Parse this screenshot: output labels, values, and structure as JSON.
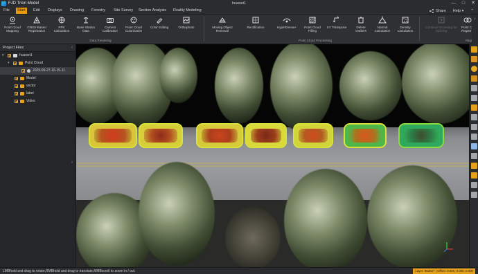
{
  "app": {
    "title": "FJD Trion Model",
    "window_title": "huawei1"
  },
  "window_controls": {
    "minimize": "—",
    "maximize": "□",
    "close": "✕"
  },
  "menu": {
    "items": [
      "File",
      "Start",
      "Edit",
      "Displays",
      "Drawing",
      "Forestry",
      "Site Survey",
      "Section Analysis",
      "Reality Modeling"
    ],
    "active": "Start",
    "share_label": "Share",
    "help_label": "Help"
  },
  "ribbon": {
    "buttons": [
      {
        "label": "Point Cloud\nMapping",
        "icon": "mapping-icon"
      },
      {
        "label": "GNSS-Based\nRegistration",
        "icon": "gnss-icon"
      },
      {
        "label": "PPK\nCalculation",
        "icon": "ppk-icon"
      },
      {
        "label": "Base Station\nData",
        "icon": "base-station-icon"
      },
      {
        "label": "Camera\nCalibration",
        "icon": "camera-icon"
      },
      {
        "label": "Point Cloud\nColorization",
        "icon": "colorize-icon"
      },
      {
        "label": "Color Editing",
        "icon": "color-edit-icon"
      },
      {
        "label": "Orthophoto",
        "icon": "orthophoto-icon"
      },
      {
        "label": "Moving Object\nRemoval",
        "icon": "moving-object-icon"
      },
      {
        "label": "Rectification",
        "icon": "rectification-icon"
      },
      {
        "label": "HyperDense+",
        "icon": "hyperdense-icon"
      },
      {
        "label": "Point Cloud\nFilling",
        "icon": "filling-icon"
      },
      {
        "label": "XY Transpose",
        "icon": "transpose-icon"
      },
      {
        "label": "Delete\nOutliers",
        "icon": "delete-outliers-icon"
      },
      {
        "label": "Normal\nCalculation",
        "icon": "normal-icon"
      },
      {
        "label": "Density\nCalculation",
        "icon": "density-icon"
      },
      {
        "label": "Continue Scanning for\nSplicing",
        "icon": "continue-scan-icon"
      },
      {
        "label": "Point C\nRegistr",
        "icon": "registration-icon"
      }
    ],
    "groups": {
      "data_resolving": "Data Resolving",
      "point_cloud_processing": "Point Cloud Processing",
      "registration_short": "Regis"
    }
  },
  "project_panel": {
    "title": "Project Files",
    "tree": [
      {
        "label": "huawei1",
        "level": 0,
        "type": "project"
      },
      {
        "label": "Point Cloud",
        "level": 1,
        "type": "folder"
      },
      {
        "label": "2025-05-27-15-15-11",
        "level": 2,
        "type": "item",
        "selected": true
      },
      {
        "label": "Model",
        "level": 1,
        "type": "folder"
      },
      {
        "label": "vector",
        "level": 1,
        "type": "folder"
      },
      {
        "label": "label",
        "level": 1,
        "type": "folder"
      },
      {
        "label": "Video",
        "level": 1,
        "type": "folder"
      }
    ]
  },
  "status": {
    "hint": "LMBhold and drag to rotate,RMBhold and drag to translate,MMBscroll to zoom in / out.",
    "right": "Layer: 962527 | Offset: 0.000, 0.000, 0.000"
  },
  "colors": {
    "accent": "#e89a13",
    "panel_bg": "#252629",
    "ribbon_bg": "#2f3034"
  }
}
